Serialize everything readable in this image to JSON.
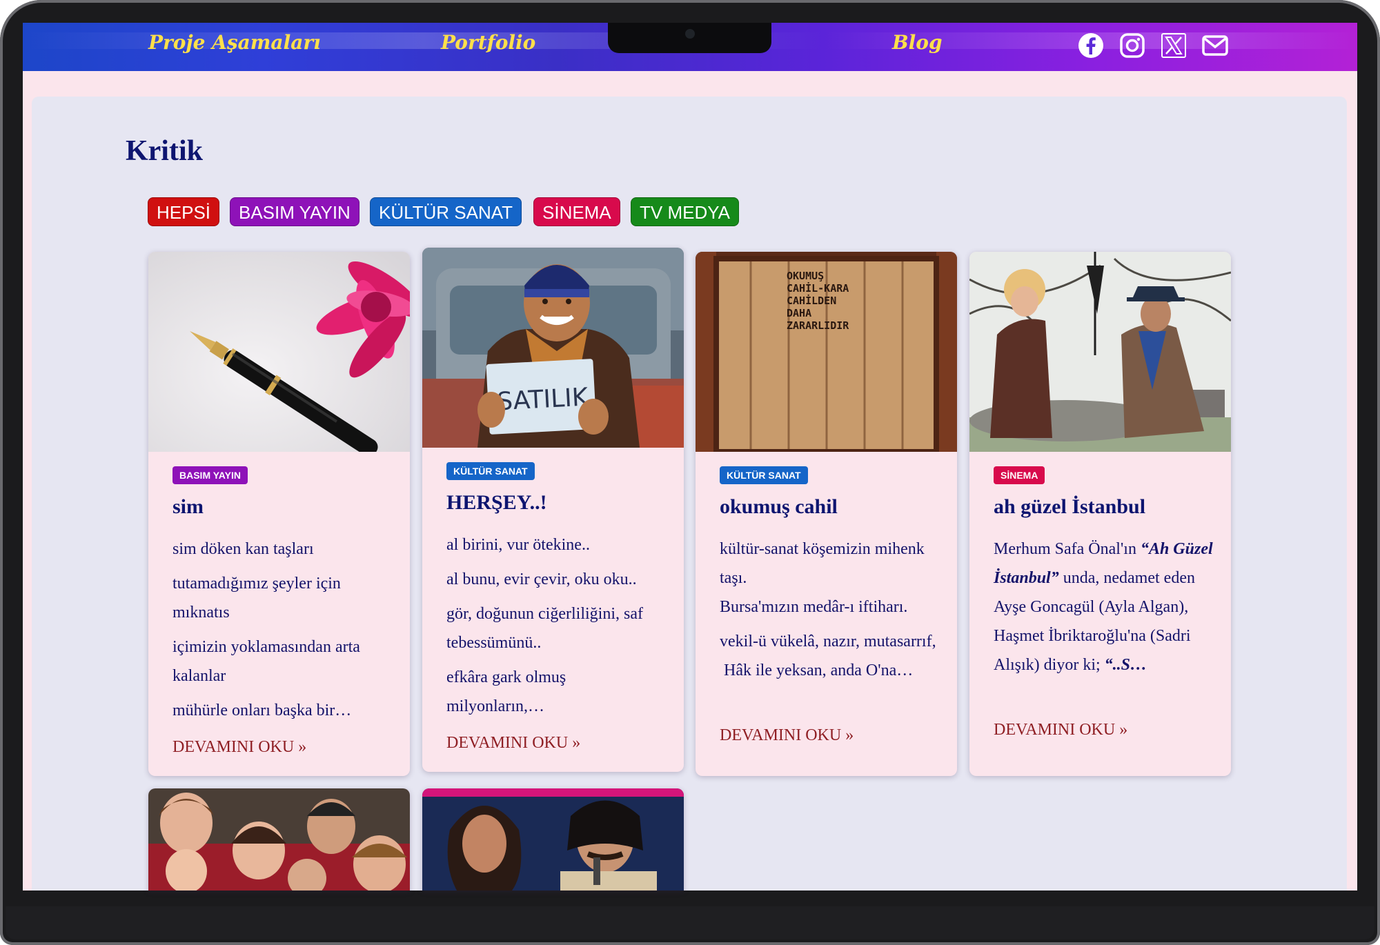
{
  "nav": {
    "links": [
      "Proje Aşamaları",
      "Portfolio",
      "Blog"
    ],
    "social": [
      "facebook-icon",
      "instagram-icon",
      "x-icon",
      "mail-icon"
    ],
    "link_color": "#ffe04a"
  },
  "page": {
    "title": "Kritik"
  },
  "filters": [
    {
      "label": "HEPSİ",
      "color": "#d01010"
    },
    {
      "label": "BASIM YAYIN",
      "color": "#8e12b8"
    },
    {
      "label": "KÜLTÜR SANAT",
      "color": "#1565c8"
    },
    {
      "label": "SİNEMA",
      "color": "#d80a4c"
    },
    {
      "label": "TV MEDYA",
      "color": "#168a1a"
    }
  ],
  "cards": [
    {
      "category": "BASIM YAYIN",
      "title": "sim",
      "excerpt": [
        "sim döken kan taşları",
        "tutamadığımız şeyler için mıknatıs",
        "içimizin yoklamasından arta kalanlar",
        "mühürle onları başka bir…"
      ],
      "more": "DEVAMINI OKU »"
    },
    {
      "category": "KÜLTÜR SANAT",
      "title": "HERŞEY..!",
      "excerpt": [
        "al birini, vur ötekine..",
        "al bunu, evir çevir, oku oku..",
        "gör, doğunun ciğerliliğini, saf tebessümünü..",
        "efkâra gark olmuş milyonların,…"
      ],
      "more": "DEVAMINI OKU »",
      "image_text": "SATILIK"
    },
    {
      "category": "KÜLTÜR SANAT",
      "title": "okumuş cahil",
      "excerpt": [
        "kültür-sanat köşemizin mihenk taşı.",
        "Bursa'mızın medâr-ı iftiharı.",
        "vekil-ü vükelâ, nazır, mutasarrıf,",
        " Hâk ile yeksan, anda O'na…"
      ],
      "more": "DEVAMINI OKU »",
      "image_text": [
        "OKUMUŞ",
        "CAHİL-KARA",
        "CAHİLDEN",
        "DAHA",
        "ZARARLIDIR"
      ]
    },
    {
      "category": "SİNEMA",
      "title": "ah güzel İstanbul",
      "excerpt": [
        "Merhum Safa Önal'ın ",
        "“Ah Güzel İstanbul”",
        " unda, nedamet eden Ayşe Goncagül (Ayla Algan), Haşmet İbriktaroğlu'na (Sadri Alışık) diyor ki; ",
        "“..S…"
      ],
      "more": "DEVAMINI OKU »"
    }
  ]
}
